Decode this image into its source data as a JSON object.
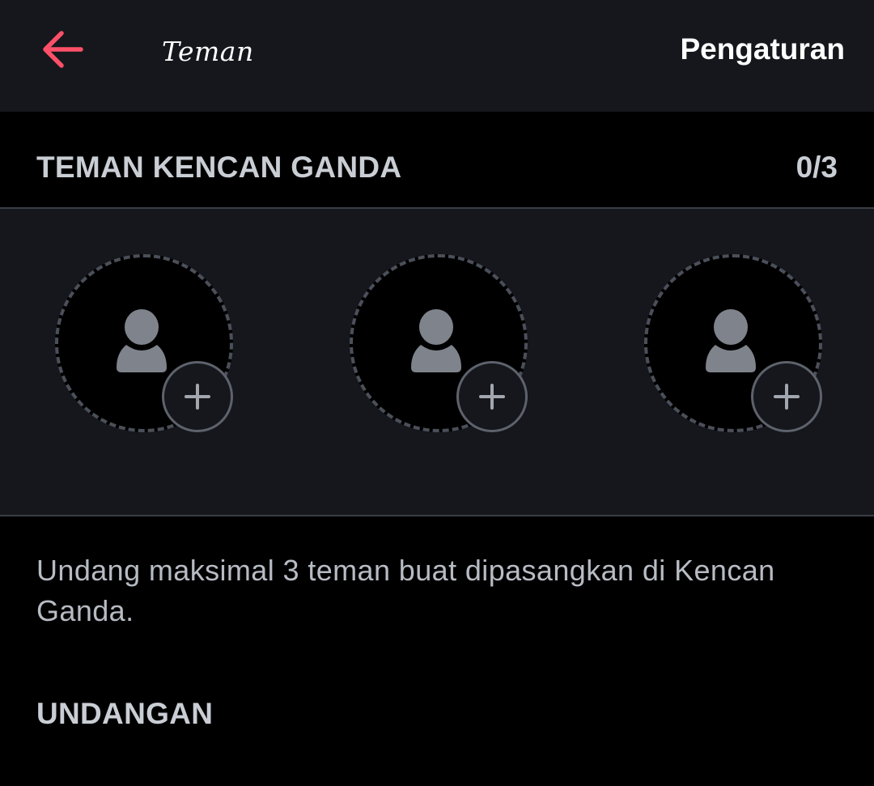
{
  "header": {
    "title": "Teman",
    "settings_label": "Pengaturan",
    "back_icon": "arrow-left-icon",
    "accent_color": "#fd5068"
  },
  "double_date": {
    "section_title": "TEMAN KENCAN GANDA",
    "count": "0/3",
    "slots": [
      {
        "avatar_icon": "person-silhouette-icon",
        "add_icon": "plus-icon"
      },
      {
        "avatar_icon": "person-silhouette-icon",
        "add_icon": "plus-icon"
      },
      {
        "avatar_icon": "person-silhouette-icon",
        "add_icon": "plus-icon"
      }
    ],
    "description": "Undang maksimal 3 teman buat dipasangkan di Kencan Ganda."
  },
  "invites": {
    "section_title": "UNDANGAN"
  }
}
